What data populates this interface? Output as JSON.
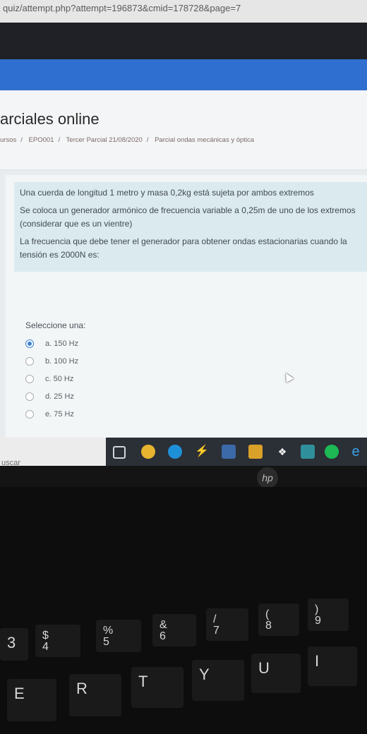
{
  "browser": {
    "url": "quiz/attempt.php?attempt=196873&cmid=178728&page=7"
  },
  "header": {
    "title": "arciales online",
    "breadcrumbs": [
      "ursos",
      "EPO001",
      "Tercer Parcial 21/08/2020",
      "Parcial ondas mecánicas y óptica"
    ]
  },
  "question": {
    "paragraphs": [
      "Una cuerda de longitud 1 metro y masa 0,2kg está sujeta por ambos extremos",
      "Se coloca un generador armónico de frecuencia variable a 0,25m de uno de los extremos (considerar que es un vientre)",
      "La frecuencia que debe tener el generador para obtener ondas estacionarias cuando la tensión es 2000N es:"
    ],
    "prompt": "Seleccione una:",
    "options": [
      {
        "label": "a. 150 Hz",
        "selected": true
      },
      {
        "label": "b. 100 Hz",
        "selected": false
      },
      {
        "label": "c. 50 Hz",
        "selected": false
      },
      {
        "label": "d. 25 Hz",
        "selected": false
      },
      {
        "label": "e. 75 Hz",
        "selected": false
      }
    ]
  },
  "taskbar": {
    "search_label": "uscar",
    "icons": [
      "task-view-icon",
      "chrome-icon",
      "edge-icon",
      "app-icon",
      "photos-icon",
      "store-icon",
      "dropbox-icon",
      "mail-icon",
      "spotify-icon",
      "ie-icon"
    ]
  },
  "laptop": {
    "logo": "hp",
    "keys": {
      "row_numbers": [
        "3",
        "$\n4",
        "%\n5",
        "&\n6",
        "/\n7",
        "(\n8",
        ")\n9"
      ],
      "row_letters": [
        "E",
        "R",
        "T",
        "Y",
        "U",
        "I"
      ]
    }
  },
  "colors": {
    "accent": "#2f6fcf",
    "question_bg": "#dbeaee",
    "radio_selected": "#3b82d6"
  }
}
